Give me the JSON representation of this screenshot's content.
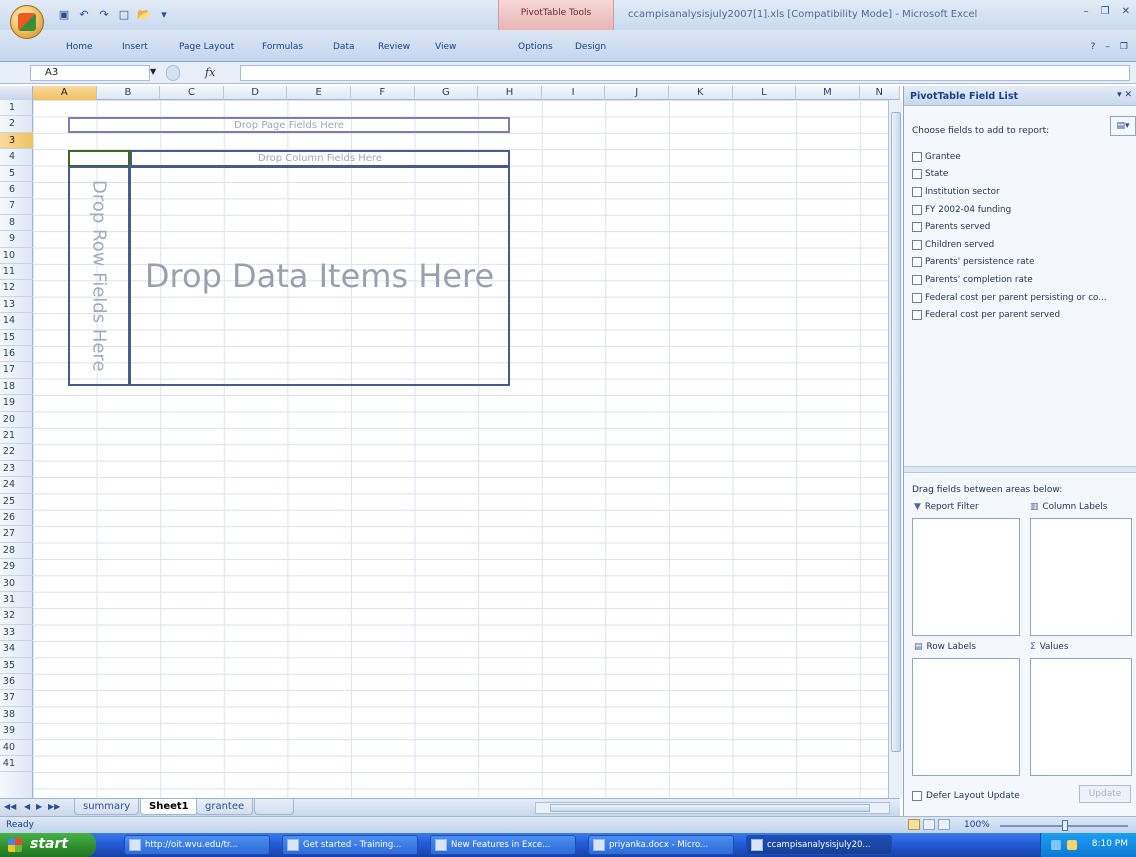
{
  "window": {
    "title": "ccampisanalysisjuly2007[1].xls  [Compatibility Mode] - Microsoft Excel",
    "contextual_tab_group": "PivotTable Tools",
    "office_button_label": "Office",
    "qat_icons": [
      "save-icon",
      "undo-icon",
      "redo-icon",
      "new-icon",
      "open-icon",
      "customize-icon"
    ]
  },
  "ribbon": {
    "tabs": [
      "Home",
      "Insert",
      "Page Layout",
      "Formulas",
      "Data",
      "Review",
      "View",
      "Options",
      "Design"
    ]
  },
  "formula_bar": {
    "name_box": "A3",
    "fx": "fx",
    "value": ""
  },
  "grid": {
    "columns": [
      "A",
      "B",
      "C",
      "D",
      "E",
      "F",
      "G",
      "H",
      "I",
      "J",
      "K",
      "L",
      "M",
      "N"
    ],
    "selected_column": "A",
    "rows": [
      "1",
      "2",
      "3",
      "4",
      "5",
      "6",
      "7",
      "8",
      "9",
      "10",
      "11",
      "12",
      "13",
      "14",
      "15",
      "16",
      "17",
      "18",
      "19",
      "20",
      "21",
      "22",
      "23",
      "24",
      "25",
      "26",
      "27",
      "28",
      "29",
      "30",
      "31",
      "32",
      "33",
      "34",
      "35",
      "36",
      "37",
      "38",
      "39",
      "40",
      "41"
    ],
    "selected_row": "3",
    "pivot_placeholders": {
      "page": "Drop Page Fields Here",
      "column": "Drop Column Fields Here",
      "row": "Drop Row Fields Here",
      "data": "Drop Data Items Here"
    }
  },
  "sheets": {
    "tabs": [
      "summary",
      "Sheet1",
      "grantee"
    ],
    "active": "Sheet1"
  },
  "status": {
    "text": "Ready",
    "zoom": "100%"
  },
  "field_list": {
    "title": "PivotTable Field List",
    "choose_label": "Choose fields to add to report:",
    "fields": [
      "Grantee",
      "State",
      "Institution sector",
      "FY 2002-04 funding",
      "Parents served",
      "Children served",
      "Parents' persistence rate",
      "Parents' completion rate",
      "Federal cost per parent persisting or co...",
      "Federal cost per parent served"
    ],
    "drag_hint": "Drag fields between areas below:",
    "areas": {
      "report_filter": "Report Filter",
      "column_labels": "Column Labels",
      "row_labels": "Row Labels",
      "values": "Values"
    },
    "defer_label": "Defer Layout Update",
    "update_label": "Update"
  },
  "taskbar": {
    "start_label": "start",
    "buttons": [
      "http://oit.wvu.edu/tr...",
      "Get started - Training...",
      "New Features in Exce...",
      "priyanka.docx - Micro...",
      "ccampisanalysisjuly20..."
    ],
    "clock": "8:10 PM"
  }
}
